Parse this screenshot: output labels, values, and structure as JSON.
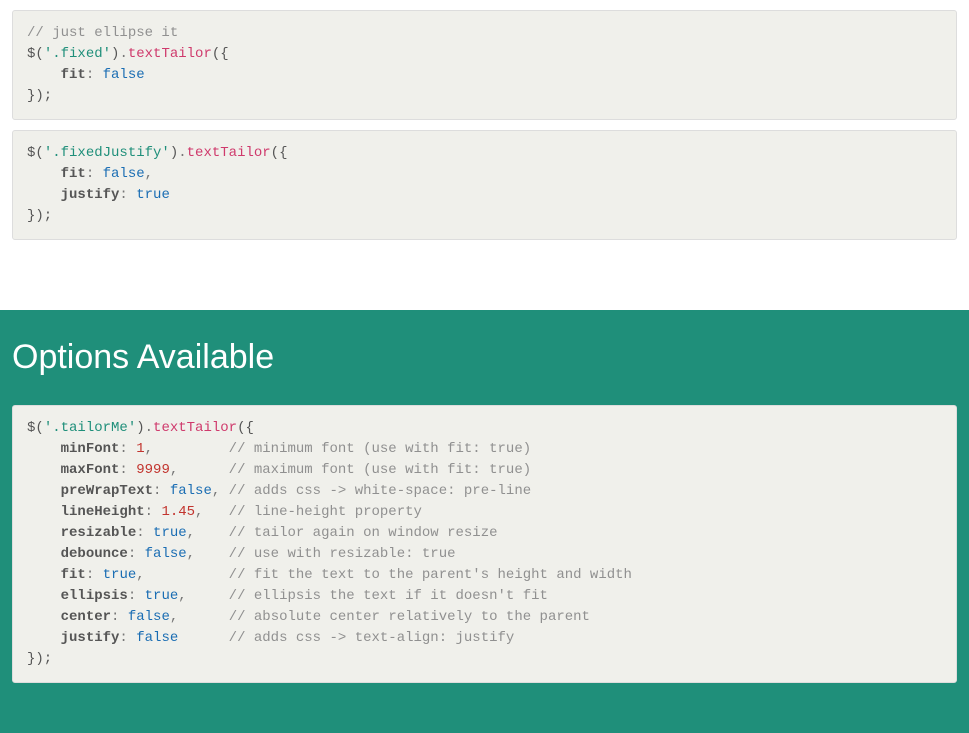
{
  "block1": {
    "comment": "// just ellipse it",
    "jq": "$(",
    "selector": "'.fixed'",
    "close_sel": ")",
    "dot": ".",
    "method": "textTailor",
    "open": "({",
    "prop_fit": "fit",
    "colon": ": ",
    "val_false": "false",
    "close": "});"
  },
  "block2": {
    "jq": "$(",
    "selector": "'.fixedJustify'",
    "close_sel": ")",
    "dot": ".",
    "method": "textTailor",
    "open": "({",
    "prop_fit": "fit",
    "val_false": "false",
    "comma": ",",
    "prop_justify": "justify",
    "val_true": "true",
    "colon": ": ",
    "close": "});"
  },
  "section_title": "Options Available",
  "block3": {
    "jq": "$(",
    "selector": "'.tailorMe'",
    "close_sel": ")",
    "dot": ".",
    "method": "textTailor",
    "open": "({",
    "colon": ": ",
    "comma": ",",
    "opts": {
      "minFont": {
        "name": "minFont",
        "val": "1",
        "type": "num",
        "comment": "// minimum font (use with fit: true)"
      },
      "maxFont": {
        "name": "maxFont",
        "val": "9999",
        "type": "num",
        "comment": "// maximum font (use with fit: true)"
      },
      "preWrapText": {
        "name": "preWrapText",
        "val": "false",
        "type": "bool",
        "comment": "// adds css -> white-space: pre-line"
      },
      "lineHeight": {
        "name": "lineHeight",
        "val": "1.45",
        "type": "num",
        "comment": "// line-height property"
      },
      "resizable": {
        "name": "resizable",
        "val": "true",
        "type": "bool",
        "comment": "// tailor again on window resize"
      },
      "debounce": {
        "name": "debounce",
        "val": "false",
        "type": "bool",
        "comment": "// use with resizable: true"
      },
      "fit": {
        "name": "fit",
        "val": "true",
        "type": "bool",
        "comment": "// fit the text to the parent's height and width"
      },
      "ellipsis": {
        "name": "ellipsis",
        "val": "true",
        "type": "bool",
        "comment": "// ellipsis the text if it doesn't fit"
      },
      "center": {
        "name": "center",
        "val": "false",
        "type": "bool",
        "comment": "// absolute center relatively to the parent"
      },
      "justify": {
        "name": "justify",
        "val": "false",
        "type": "bool",
        "comment": "// adds css -> text-align: justify"
      }
    },
    "close": "});"
  }
}
